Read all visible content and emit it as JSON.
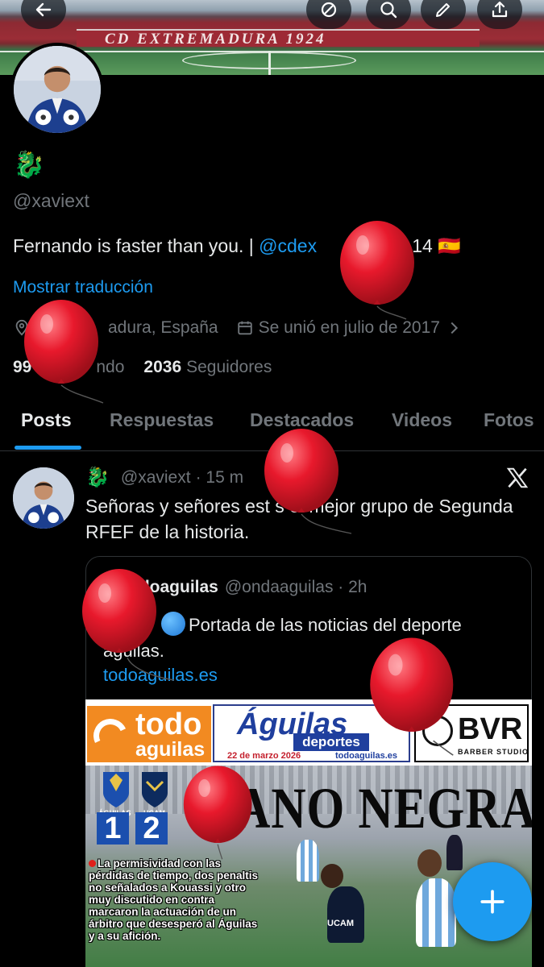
{
  "banner": {
    "stadium_text": "CD EXTREMADURA 1924"
  },
  "profile": {
    "handle": "@xaviext",
    "bio_prefix": "Fernando is faster than you. | ",
    "bio_mention": "@cdex",
    "bio_suffix": "FA14 🇪🇸",
    "translate_link": "Mostrar traducción",
    "location": "adura, España",
    "joined": "Se unió en julio de 2017",
    "following_count": "99",
    "following_label": "ndo",
    "followers_count": "2036",
    "followers_label": "Seguidores"
  },
  "tabs": [
    {
      "label": "Posts",
      "active": true
    },
    {
      "label": "Respuestas",
      "active": false
    },
    {
      "label": "Destacados",
      "active": false
    },
    {
      "label": "Videos",
      "active": false
    },
    {
      "label": "Fotos",
      "active": false
    }
  ],
  "tweet": {
    "handle": "@xaviext",
    "time": "· 15 m",
    "text": "Señoras y señores est s el mejor grupo de Segunda RFEF de la historia."
  },
  "quote": {
    "name": "odoaguilas",
    "handle": "@ondaaguilas · 2h",
    "text": "Portada de las noticias del deporte aguilas.",
    "link": "todoaguilas.es"
  },
  "cover": {
    "todo_line1": "todo",
    "todo_line2": "aguilas",
    "aguilas_title": "Águilas",
    "aguilas_sub": "deportes",
    "date": "22 de marzo 2026",
    "site": "todoaguilas.es",
    "sponsor": "BVR",
    "sponsor_sub": "BARBER STUDIO",
    "headline": "ANO NEGRA",
    "team_home": "ÁGUILAS",
    "team_away": "UCAM",
    "score_home": "1",
    "score_away": "2",
    "caption": "La permisividad con las pérdidas de tiempo, dos penaltis no señalados a Kouassi y otro muy discutido en contra marcaron la actuación de un árbitro que desesperó al Águilas y a su afición.",
    "jersey_text": "UCAM"
  },
  "colors": {
    "accent": "#1d9bf0",
    "text": "#e7e9ea",
    "muted": "#71767b",
    "balloon": "#e8192c"
  },
  "icons": [
    "back-arrow-icon",
    "mute-icon",
    "search-icon",
    "edit-icon",
    "share-icon",
    "location-pin-icon",
    "calendar-icon",
    "chevron-right-icon",
    "x-logo-icon",
    "plus-icon",
    "balloon-icon"
  ]
}
